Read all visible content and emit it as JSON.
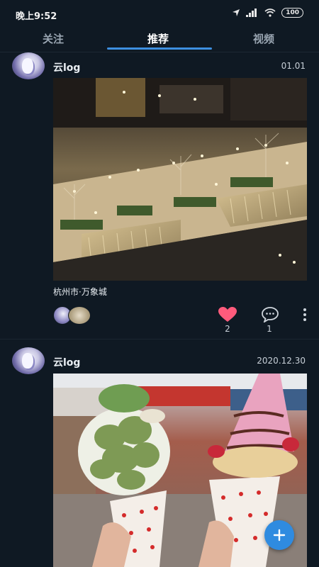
{
  "status": {
    "time": "晚上9:52",
    "battery": "100"
  },
  "tabs": [
    {
      "label": "关注"
    },
    {
      "label": "推荐",
      "active": true
    },
    {
      "label": "视频"
    }
  ],
  "posts": [
    {
      "author": "云log",
      "date": "01.01",
      "location": "杭州市·万象城",
      "likes": "2",
      "comments": "1",
      "image": "night-mall-staircase-photo"
    },
    {
      "author": "云log",
      "date": "2020.12.30",
      "image": "ice-cream-crepes-photo"
    }
  ],
  "colors": {
    "accent": "#3d8fe0",
    "heart": "#ff5b7c",
    "background": "#0f1923"
  }
}
